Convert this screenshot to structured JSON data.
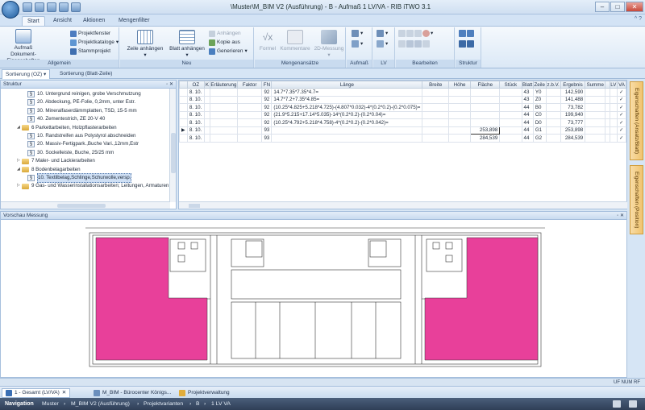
{
  "window": {
    "title": "\\Muster\\M_BIM V2 (Ausführung) - B - Aufmaß 1 LV/VA - RIB iTWO 3.1",
    "controls": [
      "–",
      "□",
      "✕"
    ]
  },
  "ribbon_tabs": [
    "Start",
    "Ansicht",
    "Aktionen",
    "Mengenfilter"
  ],
  "ribbon_control": "^ ?",
  "ribbon": {
    "allgemein": {
      "title": "Allgemein",
      "aufmass_label": "Aufmaß Dokument-Eigenschaften",
      "projektfenster": "Projektfenster",
      "projektkataloge": "Projektkataloge",
      "stammprojekt": "Stammprojekt"
    },
    "neu": {
      "title": "Neu",
      "zeile": "Zeile anhängen",
      "blatt": "Blatt anhängen",
      "anhaengen": "Anhängen",
      "kopie": "Kopie aus",
      "generieren": "Generieren"
    },
    "mengenansaetze": {
      "title": "Mengenansätze",
      "formel": "Formel",
      "kommentare": "Kommentare",
      "messung": "2D-Messung"
    },
    "aufmass": {
      "title": "Aufmaß"
    },
    "lv": {
      "title": "LV"
    },
    "bearbeiten": {
      "title": "Bearbeiten"
    },
    "struktur": {
      "title": "Struktur"
    }
  },
  "sort_tabs": [
    "Sortierung (OZ)",
    "Sortierung (Blatt-Zeile)"
  ],
  "structure": {
    "title": "Struktur",
    "items": [
      {
        "type": "para",
        "text": "10.  Untergrund reinigen, grobe Verschmutzung"
      },
      {
        "type": "para",
        "text": "20.  Abdeckung, PE-Folie, 0,2mm, unter Estr."
      },
      {
        "type": "para",
        "text": "30.  Mineralfaserdämmplatten, TSD, 15-5 mm"
      },
      {
        "type": "para",
        "text": "40.  Zementestrich, ZE 20-V 40"
      },
      {
        "type": "folder",
        "text": "6 Parkettarbeiten, Holzpflasterarbeiten"
      },
      {
        "type": "para",
        "text": "10.  Randstreifen aus Polystyrol abschneiden"
      },
      {
        "type": "para",
        "text": "20.  Massiv-Fertigpark.,Buche Vari.,12mm,Estr"
      },
      {
        "type": "para",
        "text": "30.  Sockelleiste, Buche, 25/25 mm"
      },
      {
        "type": "folder",
        "text": "7 Maler- und Lackierarbeiten"
      },
      {
        "type": "folder",
        "text": "8 Bodenbelagarbeiten"
      },
      {
        "type": "para",
        "text": "10.  Textilbelag,Schlinge,Schurwolle,versp."
      },
      {
        "type": "folder",
        "text": "9 Gas- und Wasserinstallationsarbeiten; Leitungen, Armaturen"
      }
    ]
  },
  "grid": {
    "headers": [
      "",
      "OZ",
      "K",
      "Erläuterung",
      "Faktor",
      "FN",
      "Länge",
      "Breite",
      "Höhe",
      "Fläche",
      "Stück",
      "Blatt",
      "Zeile",
      "z.b.V.",
      "Ergebnis",
      "Summe",
      "",
      "LV",
      "VA"
    ],
    "rows": [
      [
        "",
        "8. 10.",
        "",
        "",
        "",
        "92",
        "14.7*7.35*7.35*4.7=",
        "",
        "",
        "",
        "",
        "43",
        "Y0",
        "",
        "142,590",
        "",
        "",
        "",
        "✓"
      ],
      [
        "",
        "8. 10.",
        "",
        "",
        "",
        "92",
        "14.7*7.2+7.35*4.85=",
        "",
        "",
        "",
        "",
        "43",
        "Z0",
        "",
        "141,488",
        "",
        "",
        "",
        "✓"
      ],
      [
        "",
        "8. 10.",
        "",
        "",
        "",
        "92",
        "(10.25*4.825+5.218*4.725)-(4.807*0.032)-4*(0.2*0.2)-(0.2*0.075)=",
        "",
        "",
        "",
        "",
        "44",
        "B0",
        "",
        "73,782",
        "",
        "",
        "",
        "✓"
      ],
      [
        "",
        "8. 10.",
        "",
        "",
        "",
        "92",
        "(21.9*5.215+17.14*5.035)-14*(0.2*0.2)-(0.2*0.04)=",
        "",
        "",
        "",
        "",
        "44",
        "C0",
        "",
        "199,940",
        "",
        "",
        "",
        "✓"
      ],
      [
        "",
        "8. 10.",
        "",
        "",
        "",
        "92",
        "(10.25*4.792+5.218*4.758)-4*(0.2*0.2)-(0.2*0.042)=",
        "",
        "",
        "",
        "",
        "44",
        "D0",
        "",
        "73,777",
        "",
        "",
        "",
        "✓"
      ],
      [
        "▶",
        "8. 10.",
        "",
        "",
        "",
        "93",
        "",
        "",
        "",
        "253,898",
        "",
        "44",
        "G1",
        "",
        "253,898",
        "",
        "",
        "",
        "✓"
      ],
      [
        "",
        "8. 10.",
        "",
        "",
        "",
        "93",
        "",
        "",
        "",
        "284,539",
        "",
        "44",
        "G2",
        "",
        "284,539",
        "",
        "",
        "",
        "✓"
      ]
    ]
  },
  "preview": {
    "title": "Vorschau Messung"
  },
  "side_tabs": [
    "Eigenschaften (Ansatz/Blatt)",
    "Eigenschaften (Position)"
  ],
  "status": {
    "left": "",
    "right": "UF  NUM  RF"
  },
  "doc_tabs": [
    "1 - Gesamt (LV/VA)",
    "M_BIM - Bürocenter Königs...",
    "Projektverwaltung"
  ],
  "nav": {
    "label": "Navigation",
    "crumbs": [
      "Muster",
      "M_BIM V2 (Ausführung)",
      "Projektvarianten",
      "B",
      "1 LV VA"
    ]
  },
  "colors": {
    "room_fill": "#e8409a",
    "accent": "#2f5f98"
  }
}
